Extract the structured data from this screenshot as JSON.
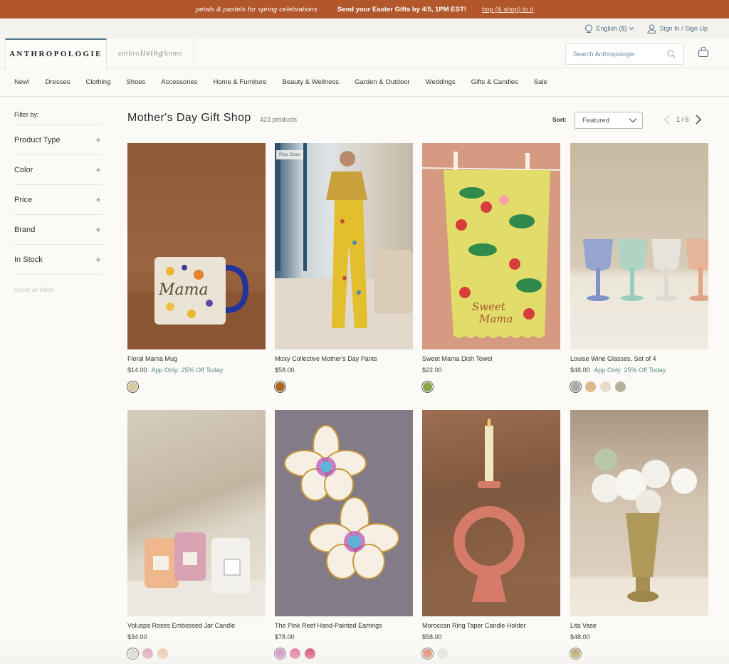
{
  "promo_banner": {
    "tagline": "petals & pastels for spring celebrations",
    "message": "Send your Easter Gifts by 4/5, 1PM EST!",
    "link": "hop (& shop) to it",
    "bg_color": "#b2562c"
  },
  "utility_bar": {
    "language": "English ($)",
    "language_icon": "globe-icon",
    "account": "Sign In / Sign Up",
    "account_icon": "user-icon"
  },
  "header": {
    "brand_primary": "ANTHROPOLOGIE",
    "brand_secondary_a": "anthro",
    "brand_secondary_b": "living",
    "brand_secondary_c": "home",
    "search_placeholder": "Search Anthropologie",
    "search_icon": "search-icon",
    "cart_icon": "shopping-bag-icon"
  },
  "nav": {
    "items": [
      "New!",
      "Dresses",
      "Clothing",
      "Shoes",
      "Accessories",
      "Home & Furniture",
      "Beauty & Wellness",
      "Garden & Outdoor",
      "Weddings",
      "Gifts & Candles",
      "Sale"
    ]
  },
  "sidebar": {
    "title": "Filter by:",
    "facets": [
      {
        "label": "Product Type",
        "icon": "+"
      },
      {
        "label": "Color",
        "icon": "+"
      },
      {
        "label": "Price",
        "icon": "+"
      },
      {
        "label": "Brand",
        "icon": "+"
      },
      {
        "label": "In Stock",
        "icon": "+"
      }
    ],
    "reset": "Reset all filters"
  },
  "main": {
    "title": "Mother's Day Gift Shop",
    "count": "423 products",
    "sort_label": "Sort:",
    "sort_value": "Featured",
    "page_current": "1",
    "page_sep": "/",
    "page_total": "5"
  },
  "products": [
    {
      "name": "Floral Mama Mug",
      "price": "$14.00",
      "promo": "App Only: 25% Off Today",
      "badge": "",
      "swatches": [
        "#d8c9a0"
      ],
      "image_desc": "floral mug on brown background"
    },
    {
      "name": "Moxy Collective Mother's Day Pants",
      "price": "$58.00",
      "promo": "",
      "badge": "Plus Sizes",
      "swatches": [
        "#a8661e"
      ],
      "image_desc": "woman in yellow floral pajama set"
    },
    {
      "name": "Sweet Mama Dish Towel",
      "price": "$22.00",
      "promo": "",
      "badge": "",
      "swatches": [
        "#8da34a"
      ],
      "image_desc": "strawberry dish towel"
    },
    {
      "name": "Louise Wine Glasses, Set of 4",
      "price": "$48.00",
      "promo": "App Only: 25% Off Today",
      "badge": "",
      "swatches": [
        "#a7aaa9",
        "#e0b98a",
        "#e6dccb",
        "#b6b29a"
      ],
      "image_desc": "four colored wine glasses"
    },
    {
      "name": "Voluspa Roses Embossed Jar Candle",
      "price": "$34.00",
      "promo": "",
      "badge": "",
      "swatches": [
        "#d8d6cf",
        "#dba6b6",
        "#eec7a2"
      ],
      "image_desc": "three jar candles"
    },
    {
      "name": "The Pink Reef Hand-Painted Earrings",
      "price": "$78.00",
      "promo": "",
      "badge": "",
      "swatches": [
        "#c77fc0",
        "#e26c98",
        "#d1456e"
      ],
      "image_desc": "flower earrings on gray"
    },
    {
      "name": "Moroccan Ring Taper Candle Holder",
      "price": "$58.00",
      "promo": "",
      "badge": "",
      "swatches": [
        "#d97d62",
        "#e4e3e0"
      ],
      "image_desc": "pink ring candle holder"
    },
    {
      "name": "Lita Vase",
      "price": "$48.00",
      "promo": "",
      "badge": "",
      "swatches": [
        "#b59a4e"
      ],
      "image_desc": "brass vase with white flowers"
    }
  ]
}
